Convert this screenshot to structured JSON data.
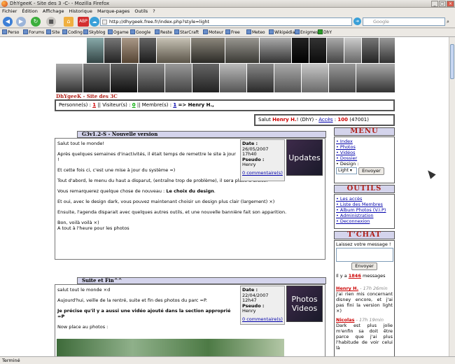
{
  "window": {
    "title": "DhYgeeK - Site des 3 -C- - Mozilla Firefox"
  },
  "menu": [
    "Fichier",
    "Édition",
    "Affichage",
    "Historique",
    "Marque-pages",
    "Outils",
    "?"
  ],
  "nav": {
    "url": "http://dhygeek.free.fr/index.php?style=light",
    "search_placeholder": "Google"
  },
  "bookmarks": [
    "Perso",
    "Forums",
    "Site",
    "Coding",
    "Skyblog",
    "Ogame",
    "Google",
    "Reste",
    "StarCraft",
    "Moteur",
    "Free",
    "Meteo",
    "Wikipédia",
    "Enigmes",
    "DhY"
  ],
  "site": {
    "banner_title": "DhYgeeK - Site des 3C",
    "stats": {
      "personnes_label": "Personne(s) :",
      "personnes": "1",
      "visiteurs_label": "Visiteur(s) :",
      "visiteurs": "0",
      "membres_label": "Membre(s) :",
      "membres": "1",
      "arrow_user": "=> Henry H.,"
    },
    "welcome": {
      "salut": "Salut",
      "user": "Henry H.",
      "group": "(DhY) -",
      "acces_label": "Accès",
      "acces": "100",
      "total": "(47001)"
    }
  },
  "articles": [
    {
      "title": "G3v1.2-S - Nouvelle version",
      "date_label": "Date :",
      "date": "26/05/2007 17h40",
      "pseudo_label": "Pseudo :",
      "pseudo": "Henry",
      "comments": "0 commentaire(s)",
      "thumb": "Updates",
      "paragraphs": [
        "Salut tout le monde!",
        "Après quelques semaines d'inactivités, il était temps de remettre le site à jour !",
        "Et cette fois ci, c'est une mise à jour du système =)",
        "Tout d'abord, le menu du haut a disparut, (entraîne trop de problème), il sera placé à droite.",
        "Ensuite, l'agenda disparait avec quelques autres outils, et une nouvelle bannière fait son apparition.",
        "Et oui, avec le design dark, vous pouvez maintenant choisir un design plus clair (largement) ×)"
      ],
      "design_prefix": "Vous remarquerez quelque chose de nouveau :",
      "design_bold": "Le choix du design",
      "ending1": "Bon, voilà voilà ×)",
      "ending2": "A tout à l'heure pour les photos"
    },
    {
      "title": "Suite et Fin^^",
      "date_label": "Date :",
      "date": "22/04/2007 12h47",
      "pseudo_label": "Pseudo :",
      "pseudo": "Henry",
      "comments": "0 commentaire(s)",
      "thumb": "Photos Videos",
      "p1": "salut tout le monde ×d",
      "p2": "Aujourd'hui, veille de la rentré, suite et fin des photos du parc =P.",
      "p3": "Je précise qu'il y a aussi une vidéo ajouté dans la section approprié =P",
      "p4": "Now place au photos :"
    }
  ],
  "sidebar": {
    "menu_title": "MENU",
    "menu_items": [
      "Index",
      "Photos",
      "Vidéos",
      "Dossier",
      "Design :"
    ],
    "design_value": "Light",
    "design_button": "Envoyer",
    "outils_title": "OUTILS",
    "outils_items": [
      "Les accès",
      "Liste des Membres",
      "Album Photos (V.I.P)",
      "Administration",
      "Deconnexion"
    ],
    "tchat_title": "T'CHAT",
    "tchat_prompt": "Laissez votre message !",
    "tchat_button": "Envoyer",
    "tchat_count_prefix": "Il y a",
    "tchat_count": "1846",
    "tchat_count_suffix": "messages",
    "messages": [
      {
        "name": "Henry H.",
        "time": "- 17h 26min",
        "text": "j'ai rien mis concernant disney encore, et j'ai pas fini la version light ×)"
      },
      {
        "name": "Nicolas",
        "time": "- 17h 19min",
        "text": "Dark est plus jolie m'enfin sa doit être parce que j'ai plus l'habitude de voir celui là"
      }
    ]
  },
  "status": "Terminé"
}
